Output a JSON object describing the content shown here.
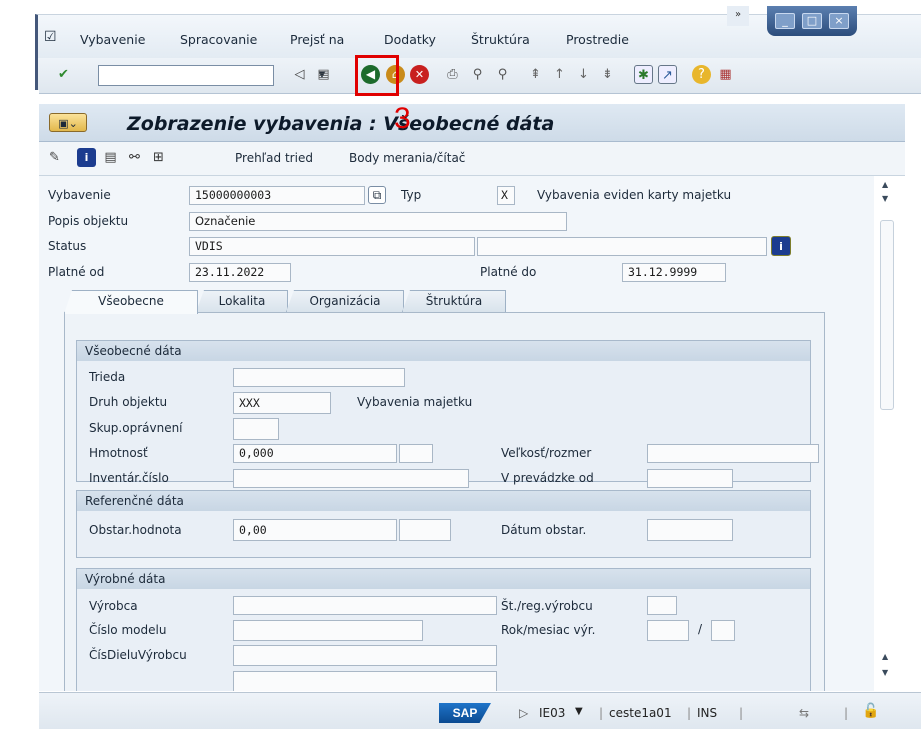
{
  "menu": {
    "items": [
      "Vybavenie",
      "Spracovanie",
      "Prejsť na",
      "Dodatky",
      "Štruktúra",
      "Prostredie"
    ]
  },
  "toolbar": {
    "command_value": ""
  },
  "annotation": {
    "step": "3"
  },
  "header": {
    "title": "Zobrazenie vybavenia : Všeobecné dáta"
  },
  "appbar": {
    "class_overview": "Prehľad tried",
    "measuring_points": "Body merania/čítač"
  },
  "equipment": {
    "vybavenie_label": "Vybavenie",
    "vybavenie_value": "15000000003",
    "typ_label": "Typ",
    "typ_value": "X",
    "typ_desc": "Vybavenia eviden karty majetku",
    "popis_label": "Popis objektu",
    "popis_value": "Označenie",
    "status_label": "Status",
    "status_value": "VDIS",
    "platne_od_label": "Platné od",
    "platne_od_value": "23.11.2022",
    "platne_do_label": "Platné do",
    "platne_do_value": "31.12.9999"
  },
  "tabs": [
    "Všeobecne",
    "Lokalita",
    "Organizácia",
    "Štruktúra"
  ],
  "general": {
    "title": "Všeobecné dáta",
    "trieda": "Trieda",
    "druh": "Druh objektu",
    "druh_value": "XXX",
    "druh_desc": "Vybavenia majetku",
    "skup": "Skup.oprávnení",
    "hmotnost": "Hmotnosť",
    "hmotnost_value": "0,000",
    "velkost": "Veľkosť/rozmer",
    "inventar": "Inventár.číslo",
    "prevadzka": "V prevádzke od"
  },
  "reference": {
    "title": "Referenčné dáta",
    "obstar": "Obstar.hodnota",
    "obstar_value": "0,00",
    "datum": "Dátum obstar."
  },
  "manufacturer": {
    "title": "Výrobné dáta",
    "vyrobca": "Výrobca",
    "st_reg": "Št./reg.výrobcu",
    "cislo_modelu": "Číslo modelu",
    "rok_mesiac": "Rok/mesiac výr.",
    "slash": "/",
    "cis_dielu": "ČísDieluVýrobcu"
  },
  "status": {
    "sap": "SAP",
    "transaction": "IE03",
    "server": "ceste1a01",
    "mode": "INS"
  }
}
